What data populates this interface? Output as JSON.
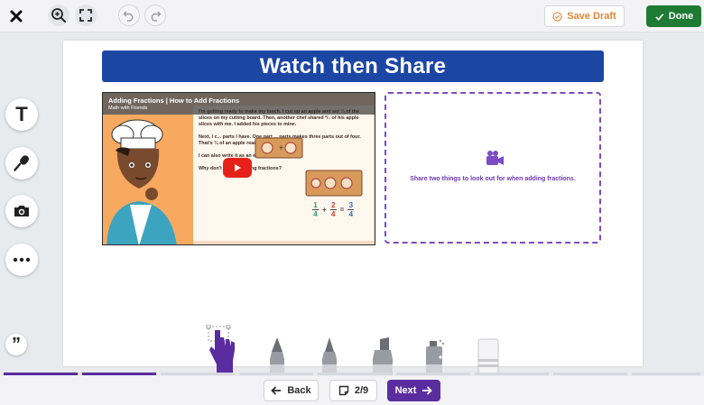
{
  "toolbar": {
    "close_icon": "close-icon",
    "zoom_icon": "zoom-in-icon",
    "fit_icon": "fullscreen-icon",
    "undo_icon": "undo-icon",
    "redo_icon": "redo-icon",
    "save_draft_label": "Save Draft",
    "done_label": "Done"
  },
  "page": {
    "title": "Watch then Share",
    "video": {
      "title": "Adding Fractions | How to Add Fractions",
      "channel": "Math with Friends",
      "line1": "I'm getting ready to make my lunch. I cut up an apple and set ¼ of the slices on my cutting board. Then, another chef shared ²/₄ of his apple slices with me. I added his pieces to mine.",
      "line2": "Next, I c... parts I have. One part ... parts makes three parts out of four. That's ¾ of an apple ready to eat.",
      "line3": "I can also write it as an equation.",
      "line4": "Why don't you try adding fractions?",
      "eq": {
        "a_num": "1",
        "a_den": "4",
        "plus": "+",
        "b_num": "2",
        "b_den": "4",
        "equals": "=",
        "c_num": "3",
        "c_den": "4"
      }
    },
    "share_prompt": "Share two things to look out for when adding fractions."
  },
  "tools": {
    "text_label": "T",
    "quote_label": "”"
  },
  "navigation": {
    "back_label": "Back",
    "page_indicator": "2/9",
    "next_label": "Next"
  },
  "progress": {
    "current_page": 2,
    "total_pages": 9
  },
  "colors": {
    "brand_purple": "#5a2ca0",
    "done_green": "#1f7a34",
    "title_blue": "#1b46a4",
    "draft_orange": "#e0863c"
  }
}
